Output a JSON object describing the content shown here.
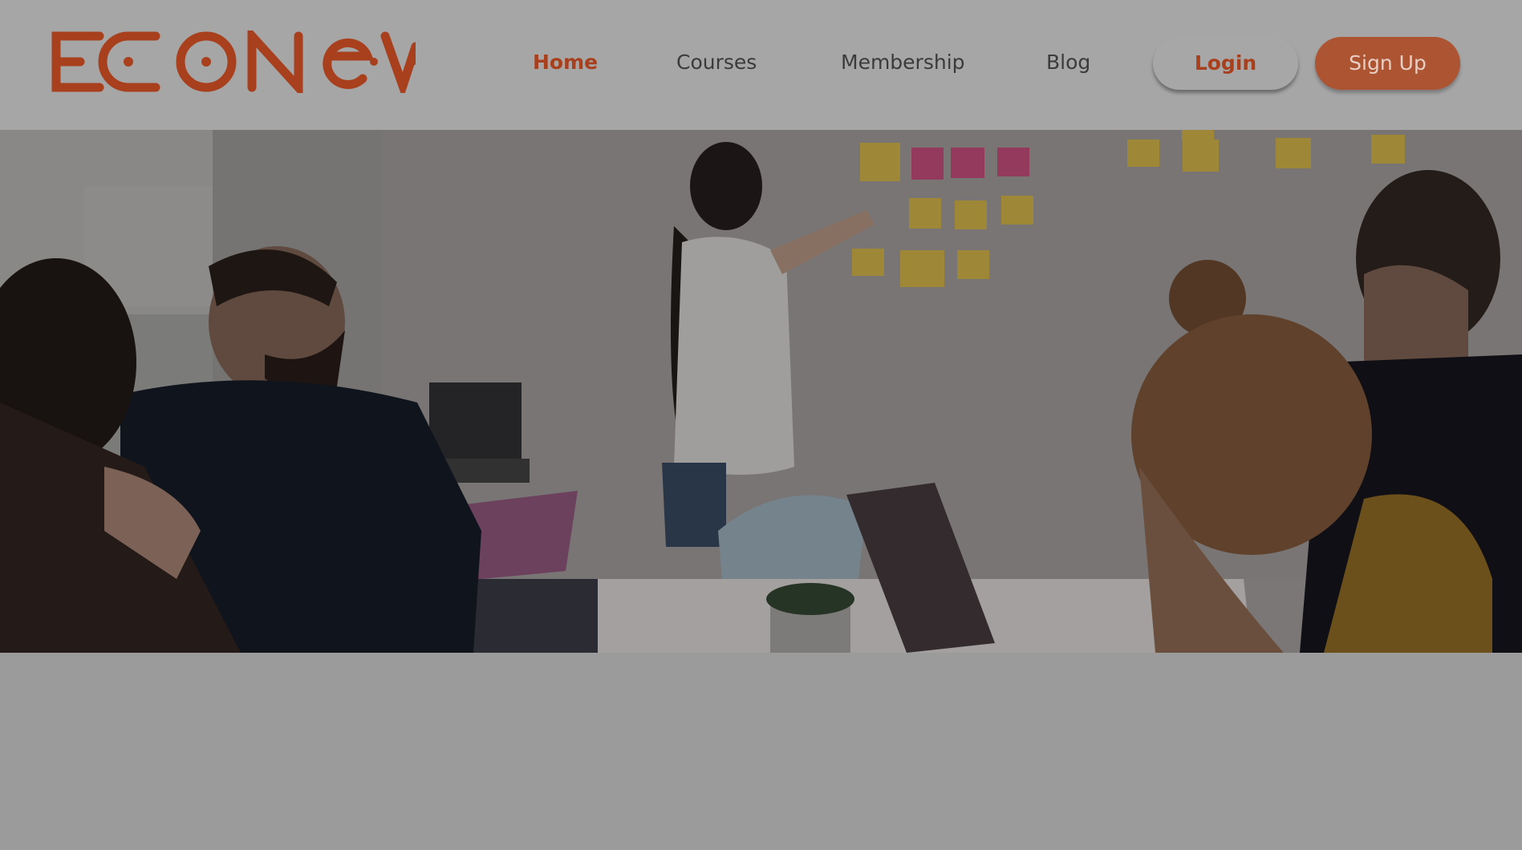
{
  "header": {
    "logo_text": "ECONEV",
    "nav": {
      "home": "Home",
      "courses": "Courses",
      "membership": "Membership",
      "blog": "Blog"
    },
    "login_label": "Login",
    "signup_label": "Sign Up"
  },
  "hero": {
    "image_description": "Team meeting in an office, woman placing sticky notes on a wall"
  },
  "colors": {
    "brand": "#a8401d",
    "signup_bg": "#ad5433",
    "header_bg": "#a6a6a6",
    "page_bg": "#9b9b9b"
  },
  "icons": [
    "econev-logo"
  ]
}
